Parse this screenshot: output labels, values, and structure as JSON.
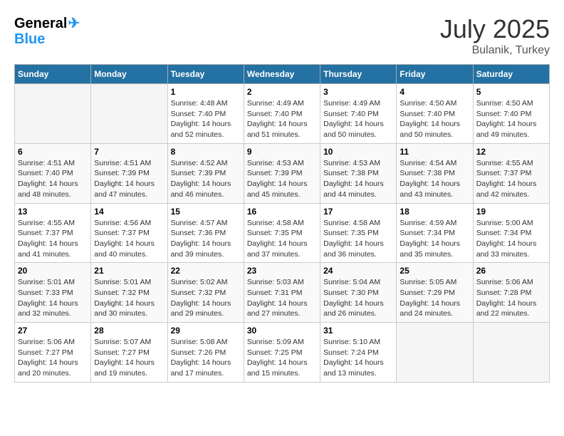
{
  "header": {
    "logo_top": "General",
    "logo_bottom": "Blue",
    "month_year": "July 2025",
    "location": "Bulanik, Turkey"
  },
  "days_of_week": [
    "Sunday",
    "Monday",
    "Tuesday",
    "Wednesday",
    "Thursday",
    "Friday",
    "Saturday"
  ],
  "weeks": [
    [
      {
        "day": "",
        "info": ""
      },
      {
        "day": "",
        "info": ""
      },
      {
        "day": "1",
        "info": "Sunrise: 4:48 AM\nSunset: 7:40 PM\nDaylight: 14 hours and 52 minutes."
      },
      {
        "day": "2",
        "info": "Sunrise: 4:49 AM\nSunset: 7:40 PM\nDaylight: 14 hours and 51 minutes."
      },
      {
        "day": "3",
        "info": "Sunrise: 4:49 AM\nSunset: 7:40 PM\nDaylight: 14 hours and 50 minutes."
      },
      {
        "day": "4",
        "info": "Sunrise: 4:50 AM\nSunset: 7:40 PM\nDaylight: 14 hours and 50 minutes."
      },
      {
        "day": "5",
        "info": "Sunrise: 4:50 AM\nSunset: 7:40 PM\nDaylight: 14 hours and 49 minutes."
      }
    ],
    [
      {
        "day": "6",
        "info": "Sunrise: 4:51 AM\nSunset: 7:40 PM\nDaylight: 14 hours and 48 minutes."
      },
      {
        "day": "7",
        "info": "Sunrise: 4:51 AM\nSunset: 7:39 PM\nDaylight: 14 hours and 47 minutes."
      },
      {
        "day": "8",
        "info": "Sunrise: 4:52 AM\nSunset: 7:39 PM\nDaylight: 14 hours and 46 minutes."
      },
      {
        "day": "9",
        "info": "Sunrise: 4:53 AM\nSunset: 7:39 PM\nDaylight: 14 hours and 45 minutes."
      },
      {
        "day": "10",
        "info": "Sunrise: 4:53 AM\nSunset: 7:38 PM\nDaylight: 14 hours and 44 minutes."
      },
      {
        "day": "11",
        "info": "Sunrise: 4:54 AM\nSunset: 7:38 PM\nDaylight: 14 hours and 43 minutes."
      },
      {
        "day": "12",
        "info": "Sunrise: 4:55 AM\nSunset: 7:37 PM\nDaylight: 14 hours and 42 minutes."
      }
    ],
    [
      {
        "day": "13",
        "info": "Sunrise: 4:55 AM\nSunset: 7:37 PM\nDaylight: 14 hours and 41 minutes."
      },
      {
        "day": "14",
        "info": "Sunrise: 4:56 AM\nSunset: 7:37 PM\nDaylight: 14 hours and 40 minutes."
      },
      {
        "day": "15",
        "info": "Sunrise: 4:57 AM\nSunset: 7:36 PM\nDaylight: 14 hours and 39 minutes."
      },
      {
        "day": "16",
        "info": "Sunrise: 4:58 AM\nSunset: 7:35 PM\nDaylight: 14 hours and 37 minutes."
      },
      {
        "day": "17",
        "info": "Sunrise: 4:58 AM\nSunset: 7:35 PM\nDaylight: 14 hours and 36 minutes."
      },
      {
        "day": "18",
        "info": "Sunrise: 4:59 AM\nSunset: 7:34 PM\nDaylight: 14 hours and 35 minutes."
      },
      {
        "day": "19",
        "info": "Sunrise: 5:00 AM\nSunset: 7:34 PM\nDaylight: 14 hours and 33 minutes."
      }
    ],
    [
      {
        "day": "20",
        "info": "Sunrise: 5:01 AM\nSunset: 7:33 PM\nDaylight: 14 hours and 32 minutes."
      },
      {
        "day": "21",
        "info": "Sunrise: 5:01 AM\nSunset: 7:32 PM\nDaylight: 14 hours and 30 minutes."
      },
      {
        "day": "22",
        "info": "Sunrise: 5:02 AM\nSunset: 7:32 PM\nDaylight: 14 hours and 29 minutes."
      },
      {
        "day": "23",
        "info": "Sunrise: 5:03 AM\nSunset: 7:31 PM\nDaylight: 14 hours and 27 minutes."
      },
      {
        "day": "24",
        "info": "Sunrise: 5:04 AM\nSunset: 7:30 PM\nDaylight: 14 hours and 26 minutes."
      },
      {
        "day": "25",
        "info": "Sunrise: 5:05 AM\nSunset: 7:29 PM\nDaylight: 14 hours and 24 minutes."
      },
      {
        "day": "26",
        "info": "Sunrise: 5:06 AM\nSunset: 7:28 PM\nDaylight: 14 hours and 22 minutes."
      }
    ],
    [
      {
        "day": "27",
        "info": "Sunrise: 5:06 AM\nSunset: 7:27 PM\nDaylight: 14 hours and 20 minutes."
      },
      {
        "day": "28",
        "info": "Sunrise: 5:07 AM\nSunset: 7:27 PM\nDaylight: 14 hours and 19 minutes."
      },
      {
        "day": "29",
        "info": "Sunrise: 5:08 AM\nSunset: 7:26 PM\nDaylight: 14 hours and 17 minutes."
      },
      {
        "day": "30",
        "info": "Sunrise: 5:09 AM\nSunset: 7:25 PM\nDaylight: 14 hours and 15 minutes."
      },
      {
        "day": "31",
        "info": "Sunrise: 5:10 AM\nSunset: 7:24 PM\nDaylight: 14 hours and 13 minutes."
      },
      {
        "day": "",
        "info": ""
      },
      {
        "day": "",
        "info": ""
      }
    ]
  ]
}
